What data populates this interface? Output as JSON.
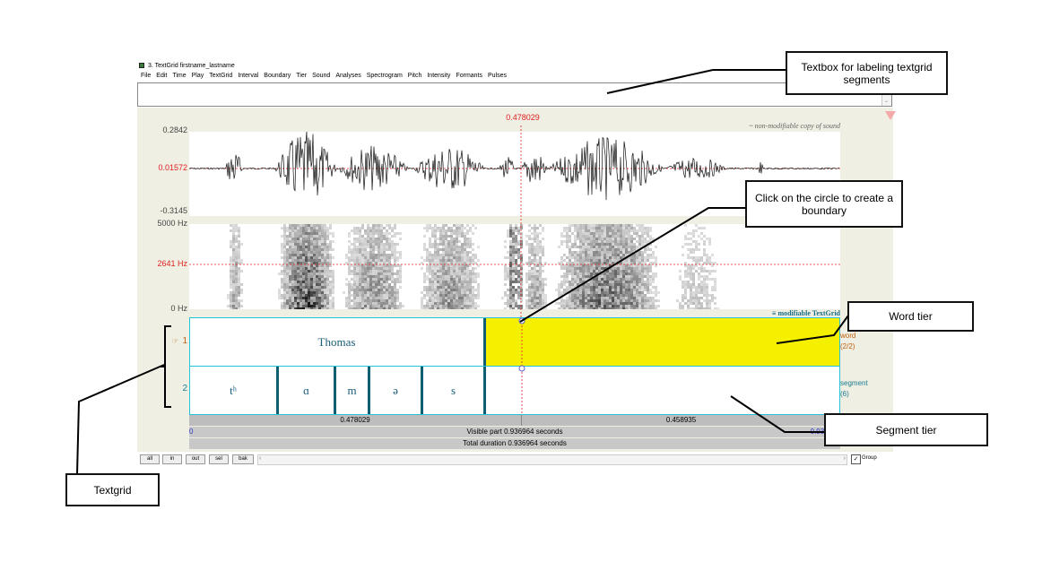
{
  "window": {
    "title": "3. TextGrid firstname_lastname",
    "menu": [
      "File",
      "Edit",
      "Time",
      "Play",
      "TextGrid",
      "Interval",
      "Boundary",
      "Tier",
      "Sound",
      "Analyses",
      "Spectrogram",
      "Pitch",
      "Intensity",
      "Formants",
      "Pulses"
    ]
  },
  "editor": {
    "cursor_time": "0.478029",
    "sound_label": "~ non-modifiable copy of sound",
    "wave_max": "0.2842",
    "wave_cursor": "0.01572",
    "wave_min": "-0.3145",
    "spec_max": "5000 Hz",
    "spec_cursor": "2641 Hz",
    "spec_min": "0 Hz",
    "textgrid_label": "modifiable TextGrid",
    "tier1_num": "1",
    "tier1_pointer": "☞",
    "tier2_num": "2",
    "tier1_name": "word",
    "tier1_count": "(2/2)",
    "tier2_name": "segment",
    "tier2_count": "(6)",
    "words": [
      "Thomas",
      ""
    ],
    "segments": [
      "tʰ",
      "ɑ",
      "m",
      "ə",
      "s",
      ""
    ],
    "left_dur": "0.478029",
    "right_dur": "0.458935",
    "view_start": "0",
    "view_end": "0.936964",
    "visible_part": "Visible part 0.936964 seconds",
    "total_duration": "Total duration 0.936964 seconds",
    "buttons": [
      "all",
      "in",
      "out",
      "sel",
      "bak"
    ],
    "group_label": "Group",
    "group_checked": true
  },
  "annotations": {
    "textbox": "Textbox for labeling textgrid segments",
    "circle": "Click on the circle to create a boundary",
    "word_tier": "Word tier",
    "segment_tier": "Segment tier",
    "textgrid": "Textgrid"
  },
  "colors": {
    "selection": "#f5f000",
    "tier_border": "#26c2d8",
    "cursor": "#e02020",
    "boundary": "#0e5f73"
  }
}
